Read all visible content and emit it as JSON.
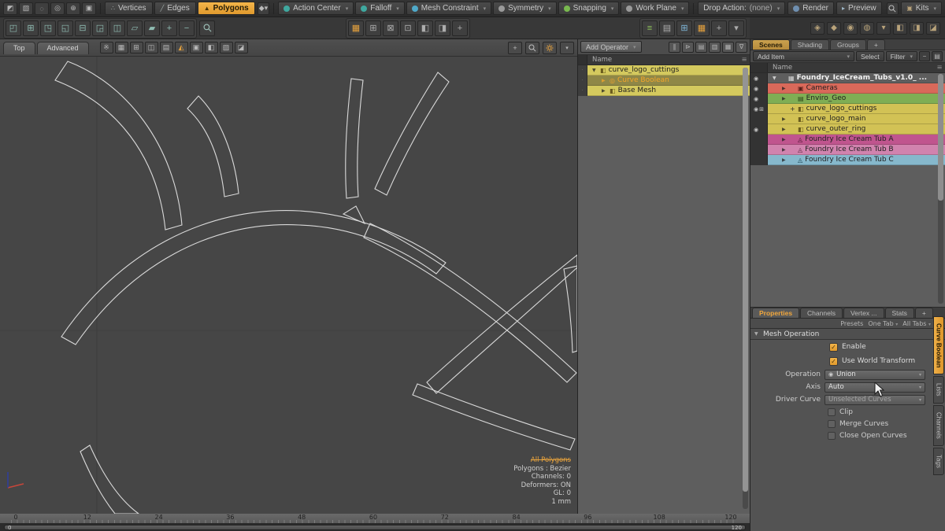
{
  "colors": {
    "accent_orange": "#e8a33d",
    "selection_yellow": "#d4c95e",
    "teal_icon": "#3fa89f",
    "row_red": "#d9695a",
    "row_green": "#7fae54",
    "row_yellow": "#d2c255",
    "row_magenta": "#c0558e",
    "row_pink": "#d183ae",
    "row_cyan": "#86b8cc"
  },
  "menubar": {
    "left_icons": [
      {
        "name": "item-select-icon",
        "glyph": "◩"
      },
      {
        "name": "paint-select-icon",
        "glyph": "▧"
      },
      {
        "name": "lasso-select-icon",
        "glyph": "◌"
      },
      {
        "name": "pivot-select-icon",
        "glyph": "◎"
      },
      {
        "name": "center-select-icon",
        "glyph": "⊕"
      },
      {
        "name": "select-through-icon",
        "glyph": "▣"
      }
    ],
    "modes": [
      {
        "name": "vertices-mode-button",
        "label": "Vertices",
        "icon": "∴",
        "active": false
      },
      {
        "name": "edges-mode-button",
        "label": "Edges",
        "icon": "╱",
        "active": false
      },
      {
        "name": "polygons-mode-button",
        "label": "Polygons",
        "icon": "▲",
        "active": true
      }
    ],
    "mode_extra_icon": "◆",
    "tools": [
      {
        "name": "action-center-dropdown",
        "label": "Action Center",
        "dot": "#3fa89f"
      },
      {
        "name": "falloff-dropdown",
        "label": "Falloff",
        "dot": "#3fa89f"
      },
      {
        "name": "mesh-constraint-dropdown",
        "label": "Mesh Constraint",
        "dot": "#4fa9c9"
      },
      {
        "name": "symmetry-dropdown",
        "label": "Symmetry",
        "dot": "#9a9a9a"
      },
      {
        "name": "snapping-dropdown",
        "label": "Snapping",
        "dot": "#79b94f"
      },
      {
        "name": "work-plane-dropdown",
        "label": "Work Plane",
        "dot": "#9a9a9a"
      }
    ],
    "drop_action_label": "Drop Action:",
    "drop_action_value": "(none)",
    "render_label": "Render",
    "preview_label": "Preview",
    "kits_label": "Kits"
  },
  "toolbar2": {
    "left_icons": [
      {
        "name": "drill-tool-icon",
        "glyph": "◰"
      },
      {
        "name": "unify-tool-icon",
        "glyph": "⊞"
      },
      {
        "name": "axis-drill-tool-icon",
        "glyph": "◳"
      },
      {
        "name": "slice-tool-icon",
        "glyph": "◱"
      },
      {
        "name": "boolean-tool-icon",
        "glyph": "⊟"
      },
      {
        "name": "bridge-tool-icon",
        "glyph": "◲"
      },
      {
        "name": "extrude-tool-icon",
        "glyph": "◫"
      },
      {
        "name": "bevel-tool-icon",
        "glyph": "▱"
      },
      {
        "name": "inset-tool-icon",
        "glyph": "▰"
      },
      {
        "name": "add-tool-icon",
        "glyph": "+"
      },
      {
        "name": "remove-tool-icon",
        "glyph": "−"
      }
    ],
    "mid_icons": [
      {
        "name": "workplane-align-icon",
        "glyph": "▦",
        "color": "#e8a33d"
      },
      {
        "name": "grid-snap-icon",
        "glyph": "⊞"
      },
      {
        "name": "plane-x-icon",
        "glyph": "⊠"
      },
      {
        "name": "plane-y-icon",
        "glyph": "⊡"
      },
      {
        "name": "plane-z-icon",
        "glyph": "◧"
      },
      {
        "name": "reset-plane-icon",
        "glyph": "◨"
      },
      {
        "name": "add-plane-icon",
        "glyph": "+"
      }
    ],
    "right_icons": [
      {
        "name": "list-toggle-icon",
        "glyph": "≡",
        "color": "#8fc25a"
      },
      {
        "name": "layout-split-icon",
        "glyph": "▤"
      },
      {
        "name": "layout-grid-icon",
        "glyph": "⊞",
        "color": "#7fb7d9"
      },
      {
        "name": "render-layout-icon",
        "glyph": "▦",
        "color": "#e8a33d"
      },
      {
        "name": "add-layout-icon",
        "glyph": "+"
      },
      {
        "name": "layout-menu-icon",
        "glyph": "▾"
      }
    ]
  },
  "rt_icons": [
    {
      "name": "pie-menu-icon",
      "glyph": "◈"
    },
    {
      "name": "popover-menu-icon",
      "glyph": "◆"
    },
    {
      "name": "forms-menu-icon",
      "glyph": "◉"
    },
    {
      "name": "presets-menu-icon",
      "glyph": "◍"
    },
    {
      "name": "menu-dropdown-icon",
      "glyph": "▾"
    },
    {
      "name": "cube-a-icon",
      "glyph": "◧"
    },
    {
      "name": "cube-b-icon",
      "glyph": "◨"
    },
    {
      "name": "cube-c-icon",
      "glyph": "◪"
    }
  ],
  "viewport": {
    "tabs": [
      {
        "name": "viewport-view-tab",
        "label": "Top"
      },
      {
        "name": "viewport-style-tab",
        "label": "Advanced"
      }
    ],
    "header_icons": [
      {
        "name": "symmetry-indicator-icon",
        "glyph": "※"
      },
      {
        "name": "shaded-toggle-icon",
        "glyph": "▦"
      },
      {
        "name": "grid-toggle-icon",
        "glyph": "⊞"
      },
      {
        "name": "workplane-toggle-icon",
        "glyph": "◫"
      },
      {
        "name": "ruler-toggle-icon",
        "glyph": "▤"
      },
      {
        "name": "action-axis-icon",
        "glyph": "◭",
        "color": "#e8a33d"
      },
      {
        "name": "lock-toggle-icon",
        "glyph": "▣"
      },
      {
        "name": "visibility-toggle-icon",
        "glyph": "◧"
      },
      {
        "name": "shadow-toggle-icon",
        "glyph": "▨"
      },
      {
        "name": "overlay-toggle-icon",
        "glyph": "◪"
      }
    ],
    "stats": [
      {
        "text": "All Polygons",
        "accent": true
      },
      {
        "text": "Polygons : Bezier"
      },
      {
        "text": "Channels: 0"
      },
      {
        "text": "Deformers: ON"
      },
      {
        "text": "GL: 0"
      },
      {
        "text": "1 mm"
      }
    ]
  },
  "meshops": {
    "add_operator": "Add Operator",
    "header_icons": [
      {
        "name": "pause-eval-icon",
        "glyph": "∥"
      },
      {
        "name": "step-eval-icon",
        "glyph": "⊳"
      },
      {
        "name": "list-view-icon",
        "glyph": "▤"
      },
      {
        "name": "tree-view-icon",
        "glyph": "▥"
      },
      {
        "name": "thumb-view-icon",
        "glyph": "▦"
      },
      {
        "name": "filter-funnel-icon",
        "glyph": "∇"
      }
    ],
    "name_header": "Name",
    "rows": [
      {
        "label": "curve_logo_cuttings",
        "arrow": "▼",
        "icon": "◧",
        "icon_color": "#6a5c1e",
        "indent": 0,
        "bg": "#d4c95e",
        "fg": "#1e1e1e"
      },
      {
        "label": "Curve Boolean",
        "arrow": "▶",
        "icon": "◎",
        "icon_color": "#f0a22e",
        "indent": 1,
        "bg": "#8f8747",
        "fg": "#f5a62a"
      },
      {
        "label": "Base Mesh",
        "arrow": "▶",
        "icon": "◧",
        "icon_color": "#6a5c1e",
        "indent": 1,
        "bg": "#d4c95e",
        "fg": "#1e1e1e"
      }
    ]
  },
  "itemlist": {
    "tabs": [
      {
        "label": "Scenes",
        "active": true
      },
      {
        "label": "Shading",
        "active": false
      },
      {
        "label": "Groups",
        "active": false
      },
      {
        "label": "+",
        "active": false
      }
    ],
    "add_item": "Add Item",
    "select": "Select",
    "filter": "Filter",
    "small_buttons": [
      {
        "name": "collapse-all-button",
        "glyph": "−"
      },
      {
        "name": "list-options-button",
        "glyph": "▤"
      }
    ],
    "name_header": "Name",
    "rows": [
      {
        "label": "Foundry_IceCream_Tubs_v1.0_ ...",
        "arrow": "▼",
        "icon": "▦",
        "icon_color": "#d8d8d8",
        "indent": 0,
        "bg": "",
        "fg": "#f2f2f2",
        "bold": true,
        "eye": true
      },
      {
        "label": "Cameras",
        "arrow": "▶",
        "icon": "▣",
        "icon_color": "#58201a",
        "indent": 1,
        "bg": "#d9695a",
        "fg": "#1e1e1e",
        "eye": true
      },
      {
        "label": "Enviro_Geo",
        "arrow": "▶",
        "icon": "▤",
        "icon_color": "#2c4718",
        "indent": 1,
        "bg": "#7fae54",
        "fg": "#1e1e1e",
        "eye": true
      },
      {
        "label": "curve_logo_cuttings",
        "arrow": "",
        "prefix": "+",
        "icon": "◧",
        "icon_color": "#6a5c1e",
        "indent": 1,
        "bg": "#d2c255",
        "fg": "#1e1e1e",
        "eye": true,
        "link": true
      },
      {
        "label": "curve_logo_main",
        "arrow": "▶",
        "icon": "◧",
        "icon_color": "#6a5c1e",
        "indent": 1,
        "bg": "#d2c255",
        "fg": "#1e1e1e"
      },
      {
        "label": "curve_outer_ring",
        "arrow": "▶",
        "icon": "◧",
        "icon_color": "#6a5c1e",
        "indent": 1,
        "bg": "#d2c255",
        "fg": "#1e1e1e",
        "eye": true
      },
      {
        "label": "Foundry Ice Cream Tub A",
        "arrow": "▶",
        "icon": "◬",
        "icon_color": "#471230",
        "indent": 1,
        "bg": "#c0558e",
        "fg": "#1e1e1e"
      },
      {
        "label": "Foundry Ice Cream Tub B",
        "arrow": "▶",
        "icon": "◬",
        "icon_color": "#57263f",
        "indent": 1,
        "bg": "#d183ae",
        "fg": "#1e1e1e"
      },
      {
        "label": "Foundry Ice Cream Tub C",
        "arrow": "▶",
        "icon": "◬",
        "icon_color": "#1c4453",
        "indent": 1,
        "bg": "#86b8cc",
        "fg": "#1e1e1e"
      }
    ]
  },
  "props": {
    "tabs": [
      {
        "label": "Properties",
        "active": true
      },
      {
        "label": "Channels",
        "active": false
      },
      {
        "label": "Vertex ...",
        "active": false
      },
      {
        "label": "Stats",
        "active": false
      },
      {
        "label": "+",
        "active": false
      }
    ],
    "presets_label": "Presets",
    "one_tab": "One Tab",
    "all_tabs": "All Tabs",
    "section": "Mesh Operation",
    "toggles": [
      {
        "label": "Enable",
        "checked": true
      },
      {
        "label": "Use World Transform",
        "checked": true
      }
    ],
    "fields": [
      {
        "label": "Operation",
        "value": "Union",
        "has_radio": true,
        "muted": false
      },
      {
        "label": "Axis",
        "value": "Auto",
        "has_radio": false,
        "muted": false
      },
      {
        "label": "Driver Curve",
        "value": "Unselected Curves",
        "has_radio": false,
        "muted": true
      }
    ],
    "options": [
      {
        "label": "Clip"
      },
      {
        "label": "Merge Curves"
      },
      {
        "label": "Close Open Curves"
      }
    ]
  },
  "side_tabs": [
    {
      "label": "Curve Boolean",
      "active": true
    },
    {
      "label": "Lists",
      "active": false
    },
    {
      "label": "Channels",
      "active": false
    },
    {
      "label": "Tags",
      "active": false
    }
  ],
  "timeline": {
    "ticks": [
      "0",
      "12",
      "24",
      "36",
      "48",
      "60",
      "72",
      "84",
      "96",
      "108",
      "120"
    ],
    "range_start": "0",
    "range_end": "120"
  }
}
